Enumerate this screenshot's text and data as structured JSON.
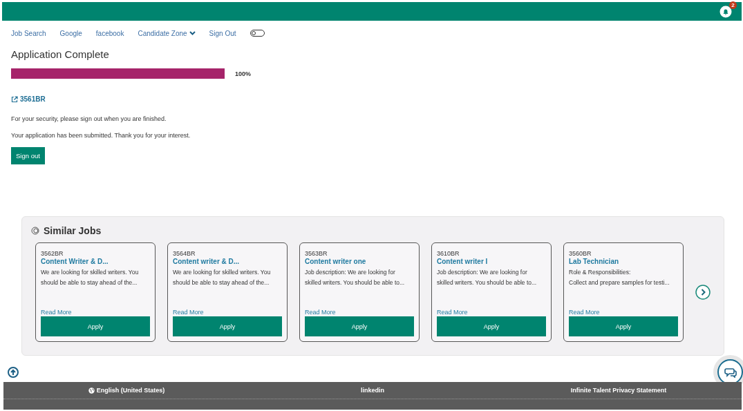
{
  "header": {
    "notification_count": "2"
  },
  "nav": {
    "links": [
      "Job Search",
      "Google",
      "facebook"
    ],
    "dropdown": "Candidate Zone",
    "sign_out": "Sign Out",
    "toggle": {
      "on": false
    }
  },
  "title": "Application Complete",
  "progress": {
    "level": 1,
    "reading": "100%"
  },
  "job_link": "3561BR",
  "messages": [
    "For your security, please sign out when you are finished.",
    "Your application has been submitted. Thank you for your interest."
  ],
  "sign_out_button": "Sign out",
  "similar_jobs": {
    "title": "Similar Jobs",
    "jobs": [
      {
        "code": "3562BR",
        "title": "Content Writer & D...",
        "lines": [
          "We are looking for skilled writers. You",
          "should be able to stay ahead of the..."
        ],
        "read_more": "Read More",
        "apply": "Apply"
      },
      {
        "code": "3564BR",
        "title": "Content writer & D...",
        "lines": [
          "We are looking for skilled writers. You",
          "should be able to stay ahead of the..."
        ],
        "read_more": "Read More",
        "apply": "Apply"
      },
      {
        "code": "3563BR",
        "title": "Content writer one",
        "lines": [
          "Job description: We are looking for",
          "skilled writers. You should be able to..."
        ],
        "read_more": "Read More",
        "apply": "Apply"
      },
      {
        "code": "3610BR",
        "title": "Content writer I",
        "lines": [
          "Job description: We are looking for",
          "skilled writers. You should be able to..."
        ],
        "read_more": "Read More",
        "apply": "Apply"
      },
      {
        "code": "3560BR",
        "title": "Lab Technician",
        "lines": [
          "Role & Responsibilities:",
          "Collect and prepare samples for testi..."
        ],
        "read_more": "Read More",
        "apply": "Apply"
      }
    ]
  },
  "footer": {
    "language": "English (United States)",
    "links": [
      "linkedin",
      "Infinite Talent Privacy Statement"
    ]
  }
}
